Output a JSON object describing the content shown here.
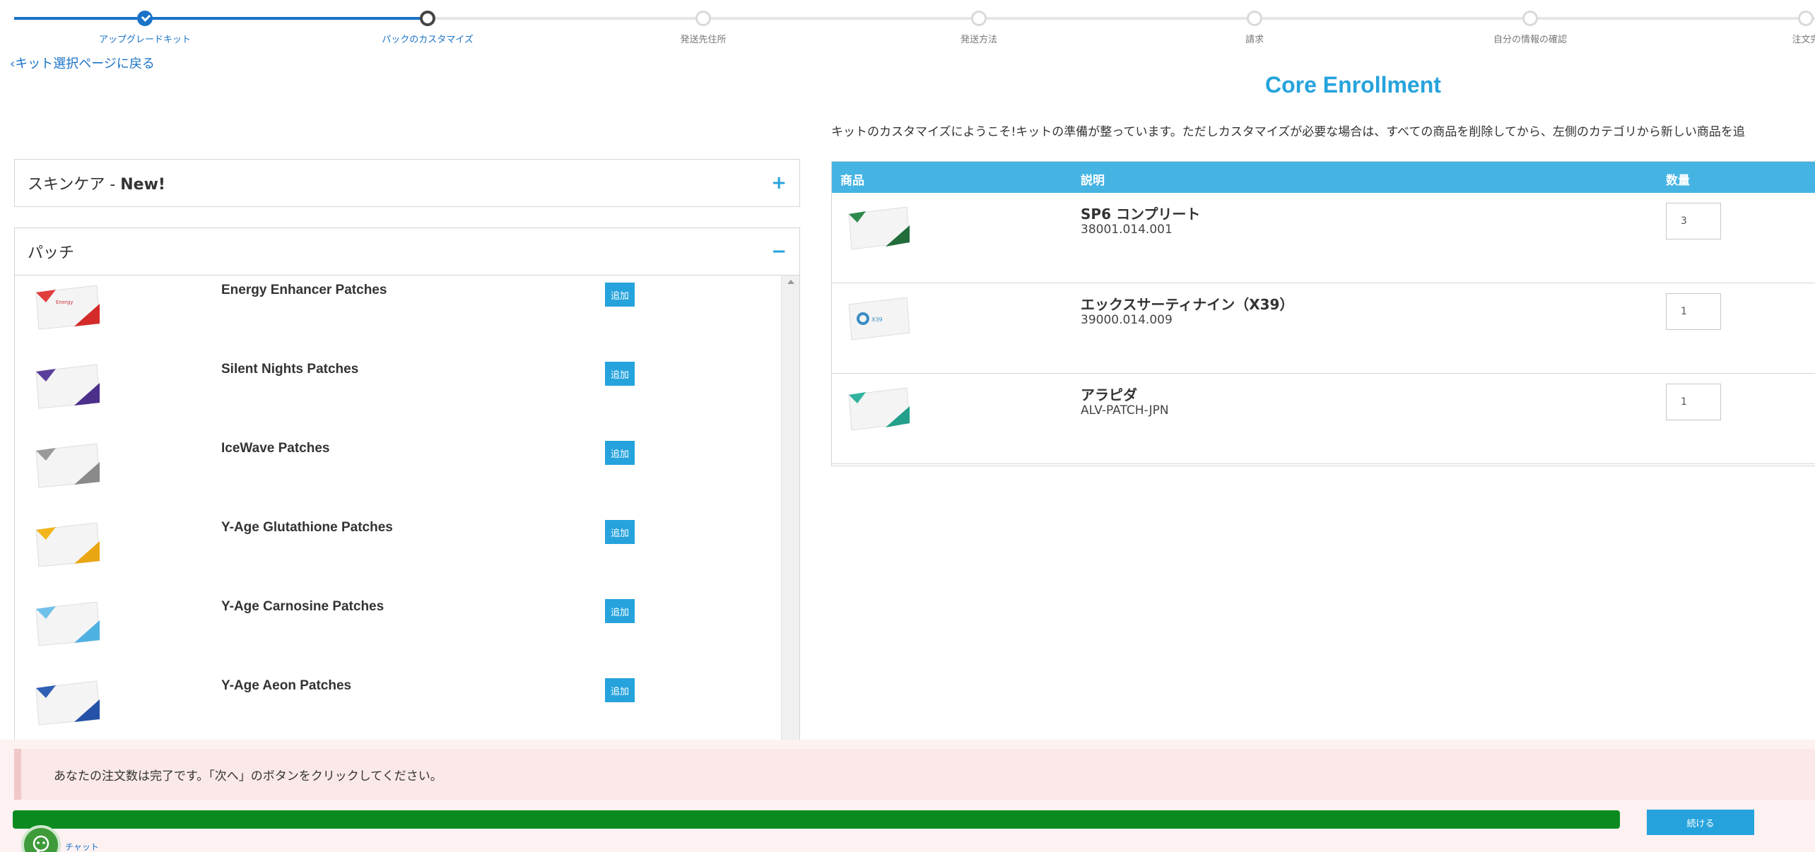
{
  "stepper": {
    "steps": [
      {
        "label": "アップグレードキット"
      },
      {
        "label": "パックのカスタマイズ"
      },
      {
        "label": "発送先住所"
      },
      {
        "label": "発送方法"
      },
      {
        "label": "請求"
      },
      {
        "label": "自分の情報の確認"
      },
      {
        "label": "注文完"
      }
    ]
  },
  "back_link": "‹キット選択ページに戻る",
  "page_title": "Core Enrollment",
  "intro_text": "キットのカスタマイズにようこそ!キットの準備が整っています。ただしカスタマイズが必要な場合は、すべての商品を削除してから、左側のカテゴリから新しい商品を追",
  "categories": {
    "skincare": {
      "label": "スキンケア - ",
      "badge": "New!",
      "toggle": "+"
    },
    "patches": {
      "label": "パッチ",
      "toggle": "−"
    }
  },
  "add_label": "追加",
  "products": [
    {
      "name": "Energy Enhancer Patches"
    },
    {
      "name": "Silent Nights Patches"
    },
    {
      "name": "IceWave Patches"
    },
    {
      "name": "Y-Age Glutathione Patches"
    },
    {
      "name": "Y-Age Carnosine Patches"
    },
    {
      "name": "Y-Age Aeon Patches"
    }
  ],
  "cart": {
    "headers": {
      "product": "商品",
      "description": "説明",
      "quantity": "数量"
    },
    "rows": [
      {
        "name": "SP6 コンプリート",
        "sku": "38001.014.001",
        "qty": "3"
      },
      {
        "name": "エックスサーティナイン（X39）",
        "sku": "39000.014.009",
        "qty": "1"
      },
      {
        "name": "アラピダ",
        "sku": "ALV-PATCH-JPN",
        "qty": "1"
      }
    ]
  },
  "notice": "あなたの注文数は完了です。「次へ」のボタンをクリックしてください。",
  "progress_fraction": 1.0,
  "next_label": "続ける",
  "chat_label": "チャット"
}
